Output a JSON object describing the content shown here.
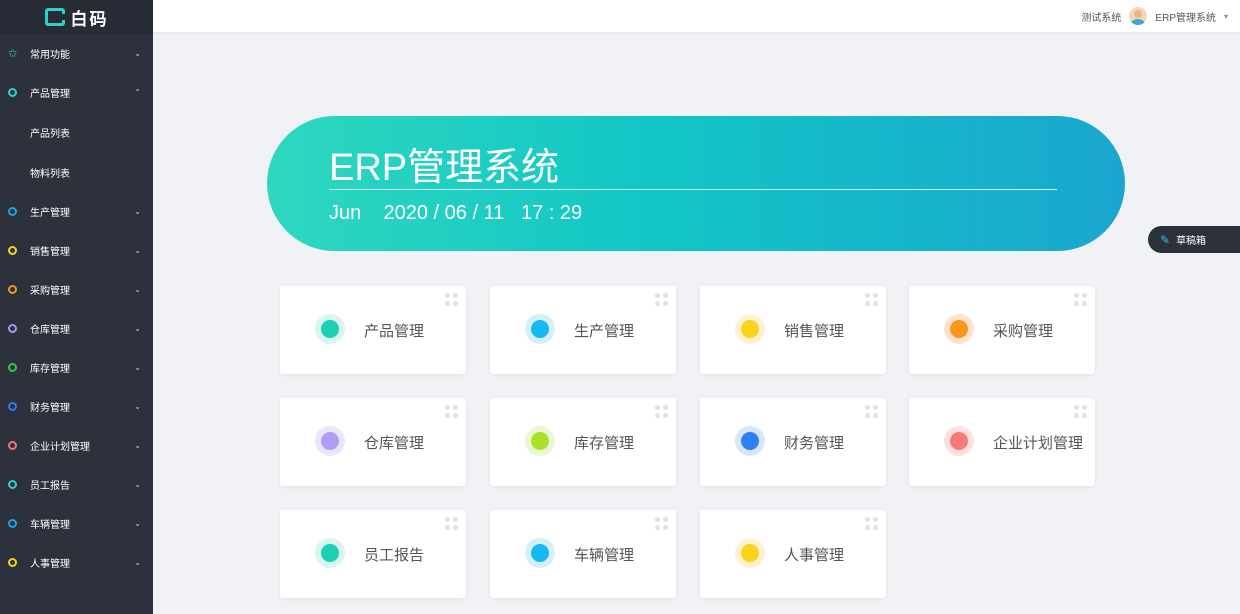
{
  "logo": {
    "text": "白码"
  },
  "sidebar": {
    "items": [
      {
        "label": "常用功能",
        "chev": "⌄",
        "color": "#2ed1c7",
        "icon": "star-icon"
      },
      {
        "label": "产品管理",
        "chev": "⌃",
        "color": "#2ed1c7",
        "expanded": true,
        "children": [
          {
            "label": "产品列表"
          },
          {
            "label": "物料列表"
          }
        ]
      },
      {
        "label": "生产管理",
        "chev": "⌄",
        "color": "#1aa6e6"
      },
      {
        "label": "销售管理",
        "chev": "⌄",
        "color": "#f7d21d"
      },
      {
        "label": "采购管理",
        "chev": "⌄",
        "color": "#f5961f"
      },
      {
        "label": "仓库管理",
        "chev": "⌄",
        "color": "#b094f3"
      },
      {
        "label": "库存管理",
        "chev": "⌄",
        "color": "#2ecc40"
      },
      {
        "label": "财务管理",
        "chev": "⌄",
        "color": "#2d7cf0"
      },
      {
        "label": "企业计划管理",
        "chev": "⌄",
        "color": "#f5746c"
      },
      {
        "label": "员工报告",
        "chev": "⌄",
        "color": "#2ed1c7"
      },
      {
        "label": "车辆管理",
        "chev": "⌄",
        "color": "#1aa6e6"
      },
      {
        "label": "人事管理",
        "chev": "⌄",
        "color": "#f7d21d"
      }
    ]
  },
  "header": {
    "test_system": "测试系统",
    "user_name": "ERP管理系统",
    "caret": "▾"
  },
  "banner": {
    "title": "ERP管理系统",
    "month": "Jun",
    "date": "2020 / 06 / 11",
    "time": "17 : 29"
  },
  "draft": {
    "label": "草稿箱",
    "icon": "edit-icon"
  },
  "cards": [
    {
      "label": "产品管理",
      "core": "#1ccfb7",
      "ring": "#d8f5f1"
    },
    {
      "label": "生产管理",
      "core": "#16b8f2",
      "ring": "#d6f0fb"
    },
    {
      "label": "销售管理",
      "core": "#fcd21c",
      "ring": "#fdf1d0"
    },
    {
      "label": "采购管理",
      "core": "#f6961b",
      "ring": "#fde3cc"
    },
    {
      "label": "仓库管理",
      "core": "#b39cf5",
      "ring": "#ece6fc"
    },
    {
      "label": "库存管理",
      "core": "#a8e02a",
      "ring": "#eaf7d2"
    },
    {
      "label": "财务管理",
      "core": "#2f7ef2",
      "ring": "#d8e6fc"
    },
    {
      "label": "企业计划管理",
      "core": "#f77a77",
      "ring": "#fde0df"
    },
    {
      "label": "员工报告",
      "core": "#1ccfb7",
      "ring": "#d8f5f1"
    },
    {
      "label": "车辆管理",
      "core": "#16b8f2",
      "ring": "#d6f0fb"
    },
    {
      "label": "人事管理",
      "core": "#fcd21c",
      "ring": "#fdf1d0"
    }
  ]
}
